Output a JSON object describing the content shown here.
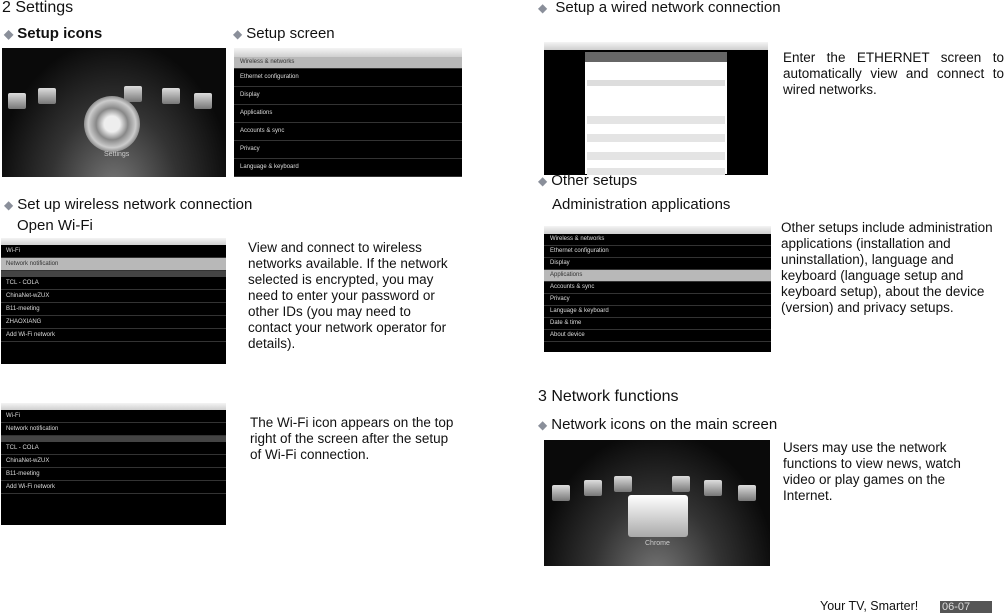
{
  "section2": {
    "title": "2 Settings",
    "setup_icons": "Setup icons",
    "setup_screen": "Setup screen",
    "wireless": "Set up wireless network connection",
    "open_wifi": "Open Wi-Fi",
    "wifi_text": "View and connect to wireless networks available. If the network selected is encrypted, you may need to enter your password or other IDs (you may need to contact your network operator for details).",
    "wifi_icon_text": "The Wi-Fi icon appears on the top right of the screen after the setup of Wi-Fi connection.",
    "setup_icon_label": "Settings",
    "wifi_list": [
      "Wi-Fi",
      "Network notification",
      "TCL - COLA",
      "ChinaNet-wZUX",
      "B11-meeting",
      "ZHAOXIANG",
      "Add Wi-Fi network"
    ],
    "wifi_list2": [
      "Wi-Fi",
      "Network notification",
      "TCL - COLA",
      "ChinaNet-wZUX",
      "B11-meeting",
      "Add Wi-Fi network"
    ]
  },
  "wired": {
    "title": "Setup a wired network connection",
    "text": "Enter the ETHERNET screen to automatically view and connect to wired networks."
  },
  "other": {
    "title": "Other setups",
    "sub": "Administration applications",
    "text": "Other setups include administration applications (installation and uninstallation), language and keyboard (language setup and keyboard setup), about the device (version) and privacy setups.",
    "menu": [
      "Wireless & networks",
      "Ethernet configuration",
      "Display",
      "Applications",
      "Accounts & sync",
      "Privacy",
      "Language & keyboard",
      "Date & time",
      "About device"
    ]
  },
  "section3": {
    "title": "3 Network functions",
    "sub": "Network icons on the main screen",
    "text": "Users may use the network functions to view news, watch video or play games on the Internet.",
    "chrome_label": "Chrome"
  },
  "footer": {
    "slogan": "Your TV, Smarter!",
    "page": "06-07"
  },
  "bullet": "◆"
}
